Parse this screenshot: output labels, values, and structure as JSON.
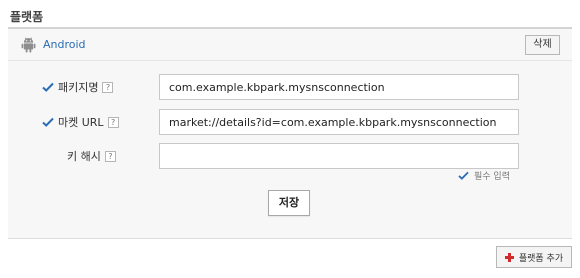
{
  "section": {
    "title": "플랫폼"
  },
  "platform": {
    "name": "Android",
    "delete_label": "삭제",
    "icon": "android-icon"
  },
  "form": {
    "package_name": {
      "label": "패키지명",
      "help": "?",
      "required": true,
      "value": "com.example.kbpark.mysnsconnection"
    },
    "market_url": {
      "label": "마켓 URL",
      "help": "?",
      "required": true,
      "value": "market://details?id=com.example.kbpark.mysnsconnection"
    },
    "key_hash": {
      "label": "키 해시",
      "help": "?",
      "required": false,
      "value": ""
    },
    "required_note": "필수 입력",
    "save_label": "저장"
  },
  "footer": {
    "add_platform_label": "플랫폼 추가"
  },
  "colors": {
    "accent": "#2a6db5",
    "check": "#2a6db5",
    "add_icon": "#d12b2b"
  }
}
